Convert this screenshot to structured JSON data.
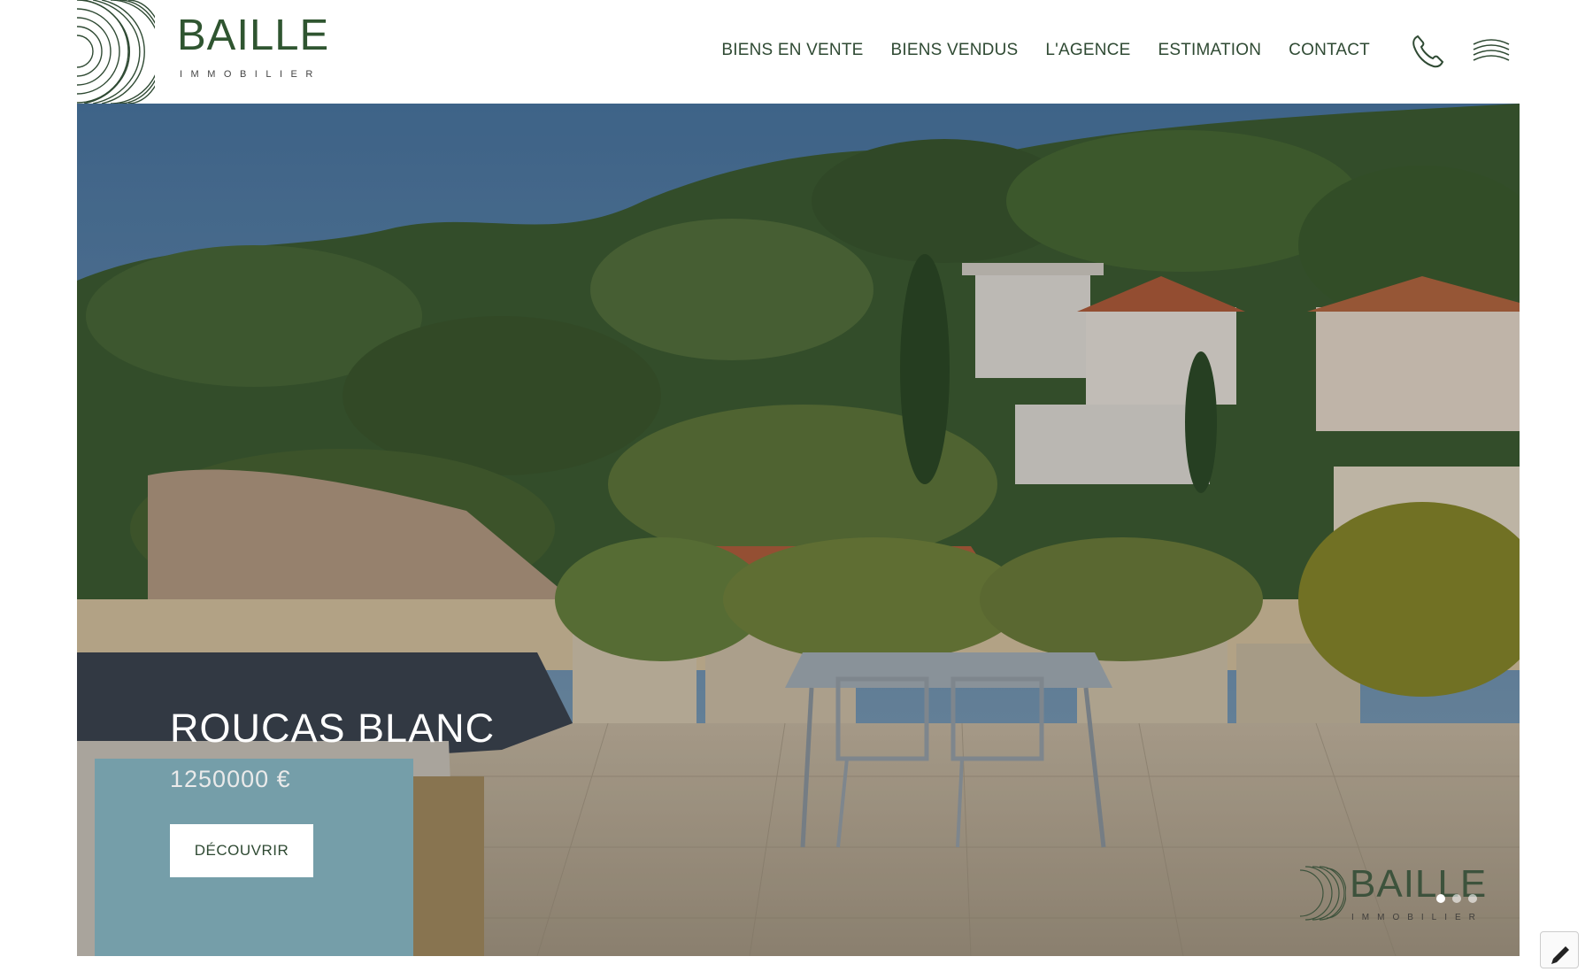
{
  "brand": {
    "name": "BAILLE",
    "subtitle": "IMMOBILIER"
  },
  "nav": {
    "items": [
      {
        "label": "BIENS EN VENTE"
      },
      {
        "label": "BIENS VENDUS"
      },
      {
        "label": "L'AGENCE"
      },
      {
        "label": "ESTIMATION"
      },
      {
        "label": "CONTACT"
      }
    ],
    "phone_icon": "phone-icon",
    "menu_icon": "menu-waves-icon"
  },
  "hero": {
    "title": "ROUCAS BLANC",
    "price": "1250000  €",
    "cta_label": "DÉCOUVRIR",
    "watermark_name": "BAILLE",
    "watermark_sub": "IMMOBILIER",
    "slides_total": 3,
    "active_slide": 1
  },
  "colors": {
    "brand_green": "#2f5530",
    "text_dark": "#2f4a33"
  },
  "edit_icon": "pencil-icon"
}
